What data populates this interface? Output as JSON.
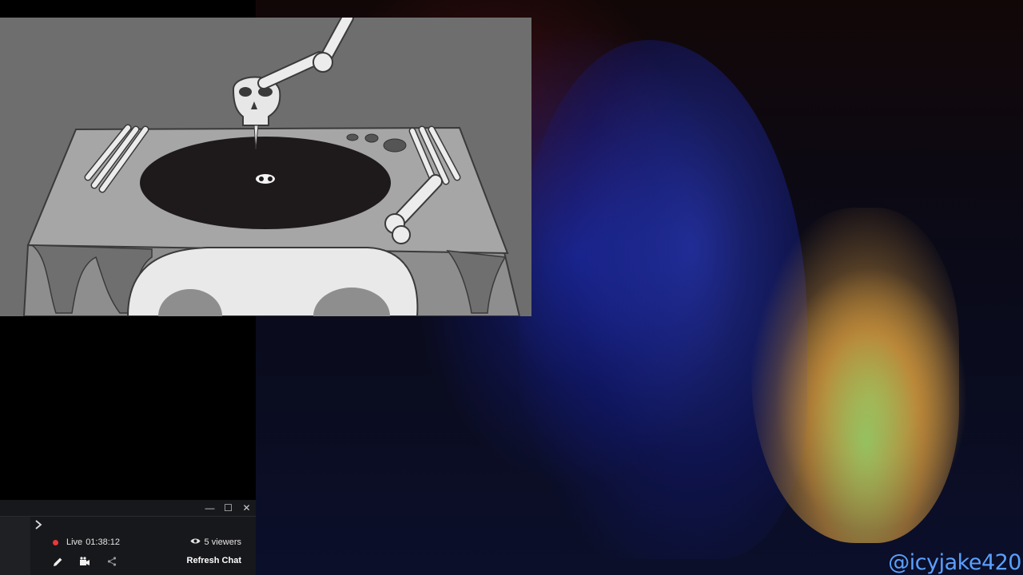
{
  "stream": {
    "live_label": "Live",
    "duration": "01:38:12",
    "viewers": "5 viewers",
    "refresh_chat_label": "Refresh Chat"
  },
  "window_controls": {
    "minimize": "—",
    "maximize": "☐",
    "close": "✕"
  },
  "icons": {
    "expand": "chevron-right-icon",
    "viewers": "eye-icon",
    "edit": "pencil-icon",
    "video": "camera-icon",
    "share": "share-icon"
  },
  "overlay": {
    "handle": "@icyjake420"
  },
  "colors": {
    "live_dot": "#e8393b",
    "handle": "#5aa0ff",
    "widget_bg": "#17181b"
  }
}
